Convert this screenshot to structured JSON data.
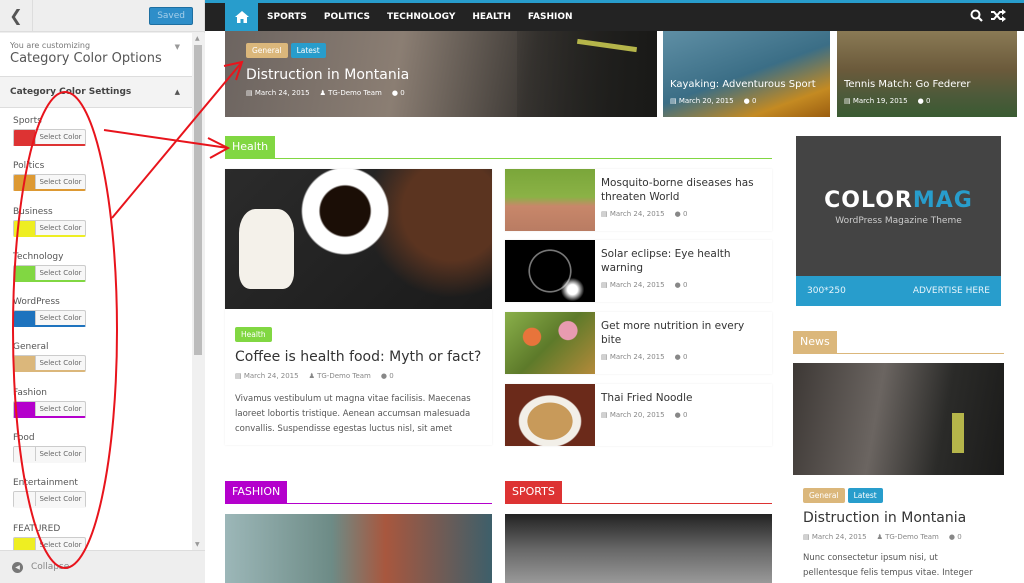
{
  "customizer": {
    "saved_label": "Saved",
    "info_small": "You are customizing",
    "info_title": "Category Color Options",
    "section_title": "Category Color Settings",
    "select_color_label": "Select Color",
    "collapse_label": "Collapse",
    "categories": [
      {
        "name": "Sports",
        "color": "#dd3333"
      },
      {
        "name": "Politics",
        "color": "#dd9933"
      },
      {
        "name": "Business",
        "color": "#eeee22"
      },
      {
        "name": "Technology",
        "color": "#81d742"
      },
      {
        "name": "WordPress",
        "color": "#1e73be"
      },
      {
        "name": "General",
        "color": "#dbb77b"
      },
      {
        "name": "Fashion",
        "color": "#b400cc"
      },
      {
        "name": "Food",
        "color": "#f7f7f7"
      },
      {
        "name": "Entertainment",
        "color": "#f7f7f7"
      },
      {
        "name": "FEATURED",
        "color": "#eeee22"
      }
    ]
  },
  "site": {
    "accent": "#289dcc",
    "nav": [
      "SPORTS",
      "POLITICS",
      "TECHNOLOGY",
      "HEALTH",
      "FASHION"
    ],
    "hero": {
      "cats": [
        {
          "label": "General",
          "color": "#dbb77b"
        },
        {
          "label": "Latest",
          "color": "#289dcc"
        }
      ],
      "title": "Distruction in Montania",
      "date": "March 24, 2015",
      "author": "TG-Demo Team",
      "comments": "0"
    },
    "thumbs": [
      {
        "title": "Kayaking: Adventurous Sport",
        "date": "March 20, 2015",
        "comments": "0"
      },
      {
        "title": "Tennis Match: Go Federer",
        "date": "March 19, 2015",
        "comments": "0"
      }
    ],
    "health": {
      "heading": "Health",
      "color": "#81d742",
      "main": {
        "cat": "Health",
        "title": "Coffee is health food: Myth or fact?",
        "date": "March 24, 2015",
        "author": "TG-Demo Team",
        "comments": "0",
        "excerpt": "Vivamus vestibulum ut magna vitae facilisis. Maecenas laoreet lobortis tristique. Aenean accumsan malesuada convallis. Suspendisse egestas luctus nisl, sit amet"
      },
      "list": [
        {
          "title": "Mosquito-borne diseases has threaten World",
          "date": "March 24, 2015",
          "comments": "0"
        },
        {
          "title": "Solar eclipse: Eye health warning",
          "date": "March 24, 2015",
          "comments": "0"
        },
        {
          "title": "Get more nutrition in every bite",
          "date": "March 24, 2015",
          "comments": "0"
        },
        {
          "title": "Thai Fried Noodle",
          "date": "March 20, 2015",
          "comments": "0"
        }
      ]
    },
    "ad": {
      "logo_a": "COLOR",
      "logo_b": "MAG",
      "sub": "WordPress Magazine Theme",
      "size": "300*250",
      "cta": "ADVERTISE HERE"
    },
    "news": {
      "heading": "News",
      "color": "#dbb77b",
      "cats": [
        {
          "label": "General",
          "color": "#dbb77b"
        },
        {
          "label": "Latest",
          "color": "#289dcc"
        }
      ],
      "title": "Distruction in Montania",
      "date": "March 24, 2015",
      "author": "TG-Demo Team",
      "comments": "0",
      "excerpt": "Nunc consectetur ipsum nisi, ut pellentesque felis tempus vitae. Integer"
    },
    "fashion": {
      "heading": "FASHION",
      "color": "#b400cc"
    },
    "sports": {
      "heading": "SPORTS",
      "color": "#dd3333"
    }
  }
}
